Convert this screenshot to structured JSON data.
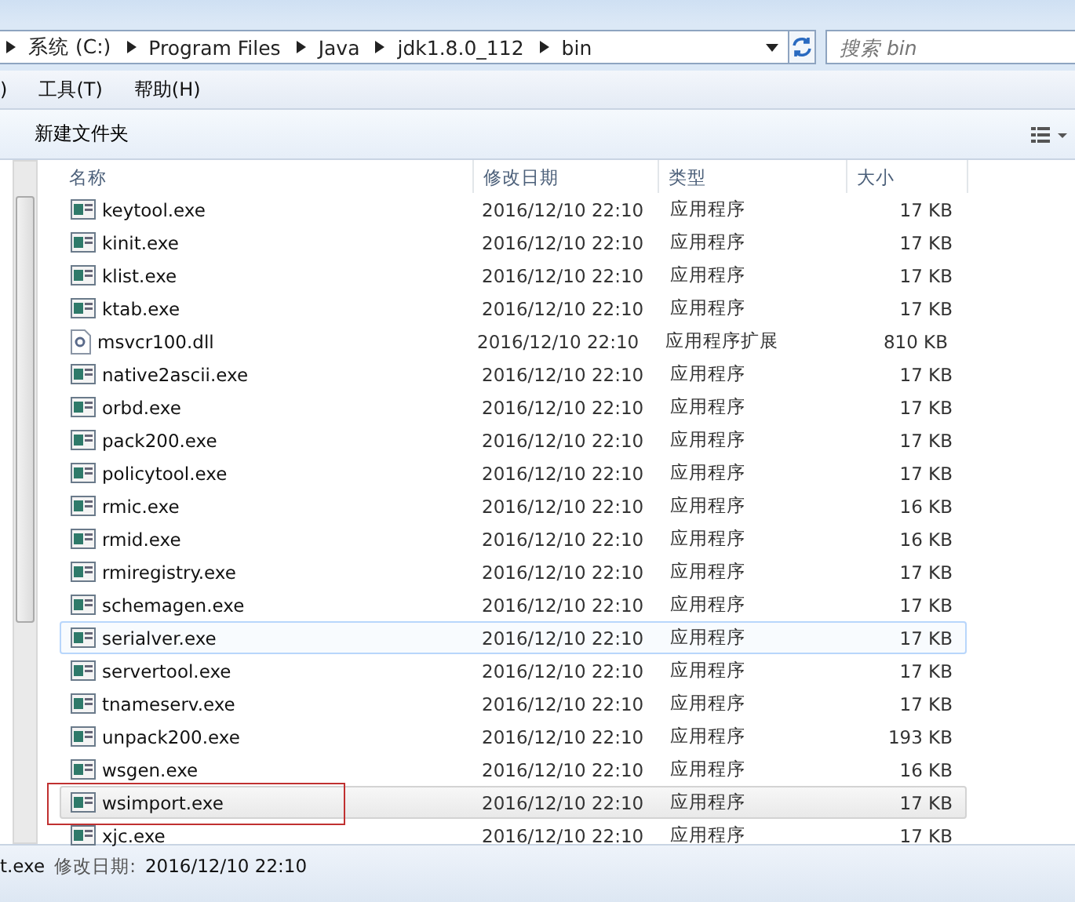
{
  "address_bar": {
    "crumbs": [
      "系统 (C:)",
      "Program Files",
      "Java",
      "jdk1.8.0_112",
      "bin"
    ]
  },
  "search": {
    "placeholder": "搜索 bin"
  },
  "menu": [
    ")",
    "工具(T)",
    "帮助(H)"
  ],
  "toolbar": {
    "new_folder": "新建文件夹"
  },
  "table": {
    "columns": [
      "名称",
      "修改日期",
      "类型",
      "大小"
    ],
    "rows": [
      {
        "name": "keytool.exe",
        "date": "2016/12/10 22:10",
        "type": "应用程序",
        "size": "17 KB",
        "kind": "exe",
        "hovered": false,
        "selected": false,
        "annotated": false
      },
      {
        "name": "kinit.exe",
        "date": "2016/12/10 22:10",
        "type": "应用程序",
        "size": "17 KB",
        "kind": "exe",
        "hovered": false,
        "selected": false,
        "annotated": false
      },
      {
        "name": "klist.exe",
        "date": "2016/12/10 22:10",
        "type": "应用程序",
        "size": "17 KB",
        "kind": "exe",
        "hovered": false,
        "selected": false,
        "annotated": false
      },
      {
        "name": "ktab.exe",
        "date": "2016/12/10 22:10",
        "type": "应用程序",
        "size": "17 KB",
        "kind": "exe",
        "hovered": false,
        "selected": false,
        "annotated": false
      },
      {
        "name": "msvcr100.dll",
        "date": "2016/12/10 22:10",
        "type": "应用程序扩展",
        "size": "810 KB",
        "kind": "dll",
        "hovered": false,
        "selected": false,
        "annotated": false
      },
      {
        "name": "native2ascii.exe",
        "date": "2016/12/10 22:10",
        "type": "应用程序",
        "size": "17 KB",
        "kind": "exe",
        "hovered": false,
        "selected": false,
        "annotated": false
      },
      {
        "name": "orbd.exe",
        "date": "2016/12/10 22:10",
        "type": "应用程序",
        "size": "17 KB",
        "kind": "exe",
        "hovered": false,
        "selected": false,
        "annotated": false
      },
      {
        "name": "pack200.exe",
        "date": "2016/12/10 22:10",
        "type": "应用程序",
        "size": "17 KB",
        "kind": "exe",
        "hovered": false,
        "selected": false,
        "annotated": false
      },
      {
        "name": "policytool.exe",
        "date": "2016/12/10 22:10",
        "type": "应用程序",
        "size": "17 KB",
        "kind": "exe",
        "hovered": false,
        "selected": false,
        "annotated": false
      },
      {
        "name": "rmic.exe",
        "date": "2016/12/10 22:10",
        "type": "应用程序",
        "size": "16 KB",
        "kind": "exe",
        "hovered": false,
        "selected": false,
        "annotated": false
      },
      {
        "name": "rmid.exe",
        "date": "2016/12/10 22:10",
        "type": "应用程序",
        "size": "16 KB",
        "kind": "exe",
        "hovered": false,
        "selected": false,
        "annotated": false
      },
      {
        "name": "rmiregistry.exe",
        "date": "2016/12/10 22:10",
        "type": "应用程序",
        "size": "17 KB",
        "kind": "exe",
        "hovered": false,
        "selected": false,
        "annotated": false
      },
      {
        "name": "schemagen.exe",
        "date": "2016/12/10 22:10",
        "type": "应用程序",
        "size": "17 KB",
        "kind": "exe",
        "hovered": false,
        "selected": false,
        "annotated": false
      },
      {
        "name": "serialver.exe",
        "date": "2016/12/10 22:10",
        "type": "应用程序",
        "size": "17 KB",
        "kind": "exe",
        "hovered": true,
        "selected": false,
        "annotated": false
      },
      {
        "name": "servertool.exe",
        "date": "2016/12/10 22:10",
        "type": "应用程序",
        "size": "17 KB",
        "kind": "exe",
        "hovered": false,
        "selected": false,
        "annotated": false
      },
      {
        "name": "tnameserv.exe",
        "date": "2016/12/10 22:10",
        "type": "应用程序",
        "size": "17 KB",
        "kind": "exe",
        "hovered": false,
        "selected": false,
        "annotated": false
      },
      {
        "name": "unpack200.exe",
        "date": "2016/12/10 22:10",
        "type": "应用程序",
        "size": "193 KB",
        "kind": "exe",
        "hovered": false,
        "selected": false,
        "annotated": false
      },
      {
        "name": "wsgen.exe",
        "date": "2016/12/10 22:10",
        "type": "应用程序",
        "size": "16 KB",
        "kind": "exe",
        "hovered": false,
        "selected": false,
        "annotated": false
      },
      {
        "name": "wsimport.exe",
        "date": "2016/12/10 22:10",
        "type": "应用程序",
        "size": "17 KB",
        "kind": "exe",
        "hovered": false,
        "selected": true,
        "annotated": true
      },
      {
        "name": "xjc.exe",
        "date": "2016/12/10 22:10",
        "type": "应用程序",
        "size": "17 KB",
        "kind": "exe",
        "hovered": false,
        "selected": false,
        "annotated": false
      }
    ]
  },
  "details": {
    "name": "t.exe",
    "date_label": "修改日期:",
    "date": "2016/12/10 22:10"
  }
}
